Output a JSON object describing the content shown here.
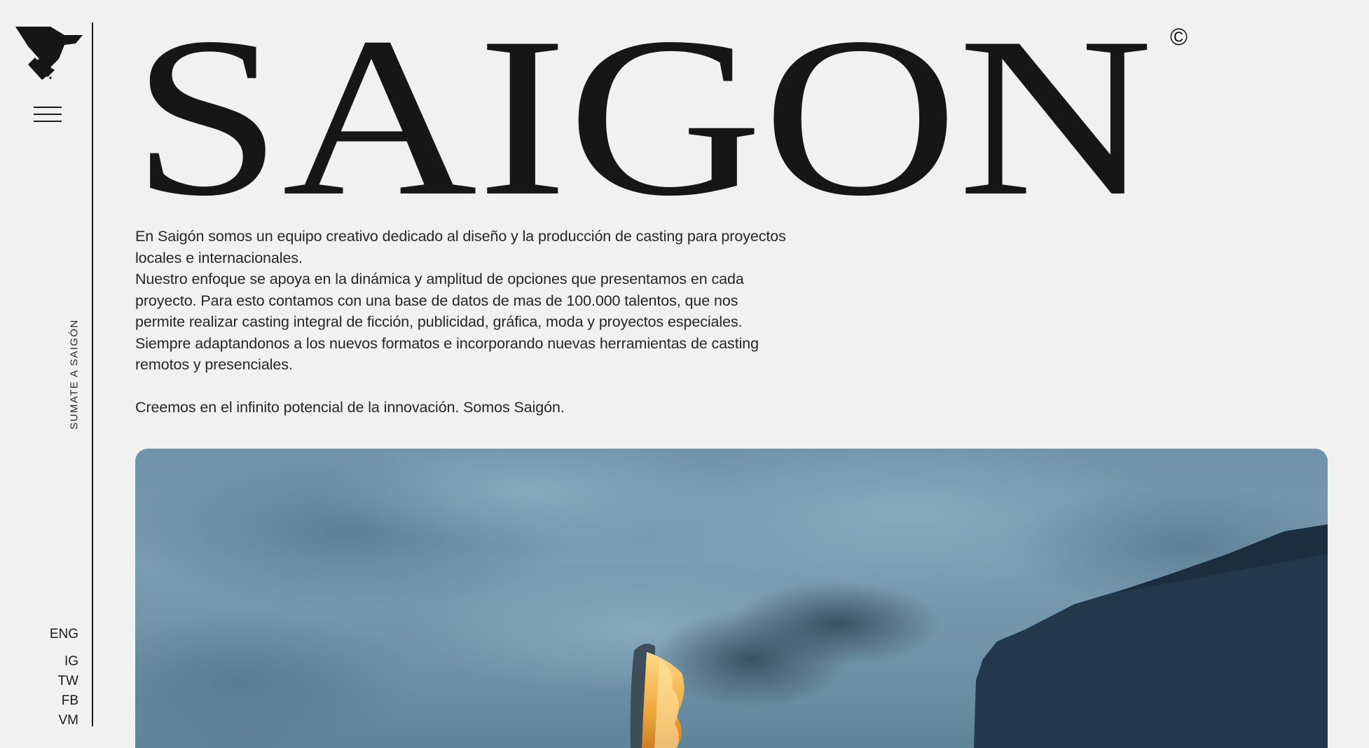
{
  "brand": {
    "name": "SAIGON",
    "copyright_symbol": "©",
    "logo_icon": "bird-logo-icon",
    "text_color": "#161616",
    "background": "#f1f1f1"
  },
  "nav": {
    "menu_icon": "hamburger-menu-icon",
    "join_label": "SUMATE A SAIGÓN",
    "language_label": "ENG",
    "social_links": [
      "IG",
      "TW",
      "FB",
      "VM"
    ]
  },
  "intro": {
    "paragraph_1": "En Saigón somos un equipo creativo dedicado al diseño y la producción de casting para proyectos locales e internacionales.",
    "paragraph_2": "Nuestro enfoque se apoya en la dinámica y amplitud de opciones que presentamos en cada proyecto.  Para esto contamos con una base de datos de mas de 100.000 talentos, que nos permite realizar casting integral de ficción, publicidad, gráfica, moda y proyectos especiales. Siempre adaptandonos a los nuevos formatos e incorporando nuevas herramientas de casting remotos y presenciales.",
    "paragraph_3": "Creemos en el infinito potencial de la innovación. Somos Saigón."
  },
  "hero": {
    "description_icon": "hero-video-frame",
    "sky_color": "#7096ad",
    "cliff_color": "#25394a",
    "fire_color": "#f0a83a"
  }
}
